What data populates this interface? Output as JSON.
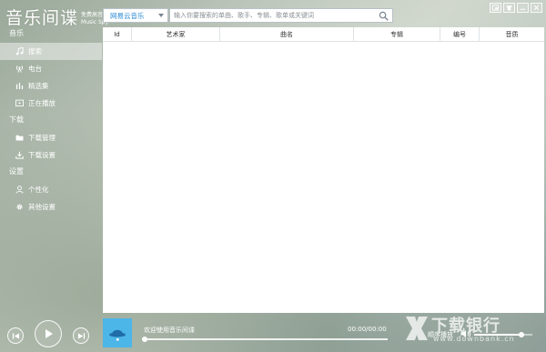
{
  "app": {
    "title": "音乐间谍",
    "subtitle_line1": "免费高音质",
    "subtitle_line2": "Music Spy"
  },
  "search": {
    "source": "网易云音乐",
    "placeholder": "输入你要搜索的单曲、歌手、专辑、歌单或关键词"
  },
  "sidebar": {
    "sections": [
      {
        "title": "音乐",
        "items": [
          {
            "label": "搜索",
            "icon": "music-note-icon",
            "active": true
          },
          {
            "label": "电台",
            "icon": "radio-icon",
            "active": false
          },
          {
            "label": "精选集",
            "icon": "chart-bars-icon",
            "active": false
          },
          {
            "label": "正在播放",
            "icon": "play-screen-icon",
            "active": false
          }
        ]
      },
      {
        "title": "下载",
        "items": [
          {
            "label": "下载管理",
            "icon": "folder-icon",
            "active": false
          },
          {
            "label": "下载设置",
            "icon": "download-icon",
            "active": false
          }
        ]
      },
      {
        "title": "设置",
        "items": [
          {
            "label": "个性化",
            "icon": "user-icon",
            "active": false
          },
          {
            "label": "其他设置",
            "icon": "gear-icon",
            "active": false
          }
        ]
      }
    ]
  },
  "table": {
    "columns": [
      "Id",
      "艺术家",
      "曲名",
      "专辑",
      "编号",
      "音质"
    ]
  },
  "player": {
    "welcome": "欢迎使用音乐间谍",
    "time": "00:00/00:00",
    "mode": "顺序播放",
    "progress": 0,
    "volume": 0.82
  },
  "watermark": {
    "text": "下载银行",
    "url": "www.downbank.cn"
  }
}
